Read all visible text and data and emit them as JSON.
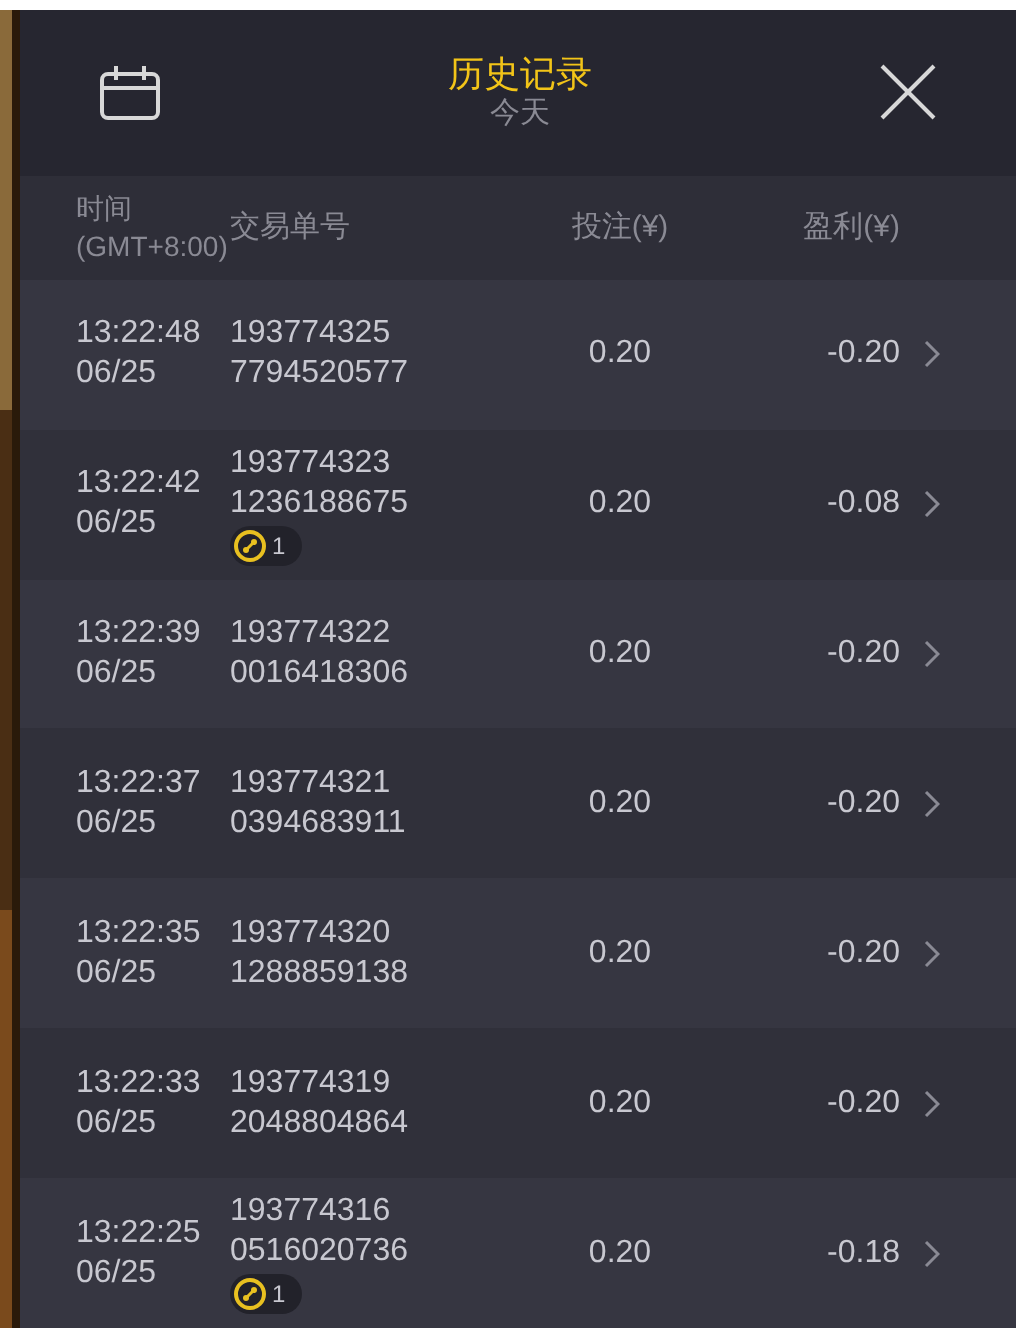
{
  "header": {
    "title": "历史记录",
    "subtitle": "今天"
  },
  "columns": [
    "时间\n(GMT+8:00)",
    "交易单号",
    "投注(¥)",
    "盈利(¥)"
  ],
  "rows": [
    {
      "time": "13:22:48",
      "date": "06/25",
      "order": "193774325\n7794520577",
      "bet": "0.20",
      "profit": "-0.20"
    },
    {
      "time": "13:22:42",
      "date": "06/25",
      "order": "193774323\n1236188675",
      "bet": "0.20",
      "profit": "-0.08",
      "badge": "1"
    },
    {
      "time": "13:22:39",
      "date": "06/25",
      "order": "193774322\n0016418306",
      "bet": "0.20",
      "profit": "-0.20"
    },
    {
      "time": "13:22:37",
      "date": "06/25",
      "order": "193774321\n0394683911",
      "bet": "0.20",
      "profit": "-0.20"
    },
    {
      "time": "13:22:35",
      "date": "06/25",
      "order": "193774320\n1288859138",
      "bet": "0.20",
      "profit": "-0.20"
    },
    {
      "time": "13:22:33",
      "date": "06/25",
      "order": "193774319\n2048804864",
      "bet": "0.20",
      "profit": "-0.20"
    },
    {
      "time": "13:22:25",
      "date": "06/25",
      "order": "193774316\n0516020736",
      "bet": "0.20",
      "profit": "-0.18",
      "badge": "1"
    }
  ]
}
